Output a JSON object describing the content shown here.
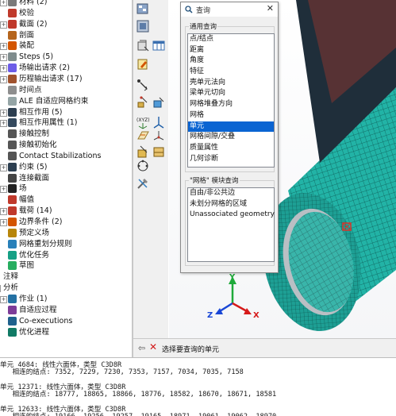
{
  "tree": {
    "items": [
      {
        "label": "材料 (2)",
        "indent": 1,
        "expander": "+",
        "icon": "material-icon",
        "color": "#7a7a7a"
      },
      {
        "label": "校验",
        "indent": 1,
        "expander": "",
        "icon": "calibration-icon",
        "color": "#c0392b"
      },
      {
        "label": "截面 (2)",
        "indent": 1,
        "expander": "+",
        "icon": "section-icon",
        "color": "#c0392b"
      },
      {
        "label": "剖面",
        "indent": 1,
        "expander": "",
        "icon": "profile-icon",
        "color": "#b5651d"
      },
      {
        "label": "装配",
        "indent": 1,
        "expander": "+",
        "icon": "assembly-icon",
        "color": "#d35400"
      },
      {
        "label": "Steps (5)",
        "indent": 1,
        "expander": "+",
        "icon": "steps-icon",
        "color": "#7f8c8d"
      },
      {
        "label": "场输出请求 (2)",
        "indent": 1,
        "expander": "+",
        "icon": "field-output-icon",
        "color": "#6c5ce7"
      },
      {
        "label": "历程输出请求 (17)",
        "indent": 1,
        "expander": "+",
        "icon": "history-output-icon",
        "color": "#a0522d"
      },
      {
        "label": "时间点",
        "indent": 1,
        "expander": "",
        "icon": "time-points-icon",
        "color": "#8e8e8e"
      },
      {
        "label": "ALE 自适应网格约束",
        "indent": 1,
        "expander": "",
        "icon": "ale-constraint-icon",
        "color": "#95a5a6"
      },
      {
        "label": "相互作用 (5)",
        "indent": 1,
        "expander": "+",
        "icon": "interaction-icon",
        "color": "#2c3e50"
      },
      {
        "label": "相互作用属性 (1)",
        "indent": 1,
        "expander": "+",
        "icon": "interaction-property-icon",
        "color": "#34495e"
      },
      {
        "label": "接触控制",
        "indent": 1,
        "expander": "",
        "icon": "contact-control-icon",
        "color": "#555"
      },
      {
        "label": "接触初始化",
        "indent": 1,
        "expander": "",
        "icon": "contact-init-icon",
        "color": "#555"
      },
      {
        "label": "Contact Stabilizations",
        "indent": 1,
        "expander": "",
        "icon": "contact-stabilization-icon",
        "color": "#555"
      },
      {
        "label": "约束 (5)",
        "indent": 1,
        "expander": "+",
        "icon": "constraint-icon",
        "color": "#2c3e50"
      },
      {
        "label": "连接截面",
        "indent": 1,
        "expander": "",
        "icon": "connector-section-icon",
        "color": "#444"
      },
      {
        "label": "场",
        "indent": 1,
        "expander": "+",
        "icon": "field-icon",
        "color": "#222"
      },
      {
        "label": "幅值",
        "indent": 1,
        "expander": "",
        "icon": "amplitude-icon",
        "color": "#c0392b"
      },
      {
        "label": "载荷 (14)",
        "indent": 1,
        "expander": "+",
        "icon": "load-icon",
        "color": "#c0392b"
      },
      {
        "label": "边界条件 (2)",
        "indent": 1,
        "expander": "+",
        "icon": "boundary-condition-icon",
        "color": "#d35400"
      },
      {
        "label": "预定义场",
        "indent": 1,
        "expander": "",
        "icon": "predefined-field-icon",
        "color": "#b8860b"
      },
      {
        "label": "网格重划分规则",
        "indent": 1,
        "expander": "",
        "icon": "remeshing-rule-icon",
        "color": "#2980b9"
      },
      {
        "label": "优化任务",
        "indent": 1,
        "expander": "",
        "icon": "optimization-task-icon",
        "color": "#16a085"
      },
      {
        "label": "草图",
        "indent": 1,
        "expander": "",
        "icon": "sketch-icon",
        "color": "#27ae60"
      },
      {
        "label": "注释",
        "indent": 0,
        "expander": "",
        "icon": "",
        "color": ""
      },
      {
        "label": "分析",
        "indent": 0,
        "expander": "-",
        "icon": "",
        "color": ""
      },
      {
        "label": "作业 (1)",
        "indent": 1,
        "expander": "+",
        "icon": "job-icon",
        "color": "#2471a3"
      },
      {
        "label": "自适应过程",
        "indent": 1,
        "expander": "",
        "icon": "adaptivity-icon",
        "color": "#7d3c98"
      },
      {
        "label": "Co-executions",
        "indent": 1,
        "expander": "",
        "icon": "co-execution-icon",
        "color": "#1f618d"
      },
      {
        "label": "优化进程",
        "indent": 1,
        "expander": "",
        "icon": "optimization-process-icon",
        "color": "#117a65"
      }
    ]
  },
  "query_dialog": {
    "title": "查询",
    "general_group_label": "通用查询",
    "general_items": [
      "点/结点",
      "距离",
      "角度",
      "特征",
      "壳单元法向",
      "梁单元切向",
      "网格堆叠方向",
      "网格",
      "单元",
      "网格间隙/交叠",
      "质量属性",
      "几何诊断"
    ],
    "selected_index": 8,
    "mesh_group_label": "\"网格\" 模块查询",
    "mesh_items": [
      "自由/非公共边",
      "未划分网格的区域",
      "Unassociated geometry"
    ]
  },
  "triad": {
    "y_label": "Y",
    "z_label": "Z",
    "x_label": "X"
  },
  "prompt": {
    "text": "选择要查询的单元"
  },
  "messages": [
    "单元 4684: 线性六面体，类型 C3D8R",
    "   相连的结点: 7352, 7229, 7230, 7353, 7157, 7034, 7035, 7158",
    "",
    "单元 12371: 线性六面体，类型 C3D8R",
    "   相连的结点: 18777, 18865, 18866, 18776, 18582, 18670, 18671, 18581",
    "",
    "单元 12633: 线性六面体，类型 C3D8R",
    "   相连的结点: 19166, 19256, 19257, 19165, 18971, 19061, 19062, 18970"
  ],
  "colors": {
    "mesh": "#22b3a6",
    "mesh_dark": "#13807a",
    "selection": "#0a64d2",
    "picked_marker": "#d9342b"
  }
}
